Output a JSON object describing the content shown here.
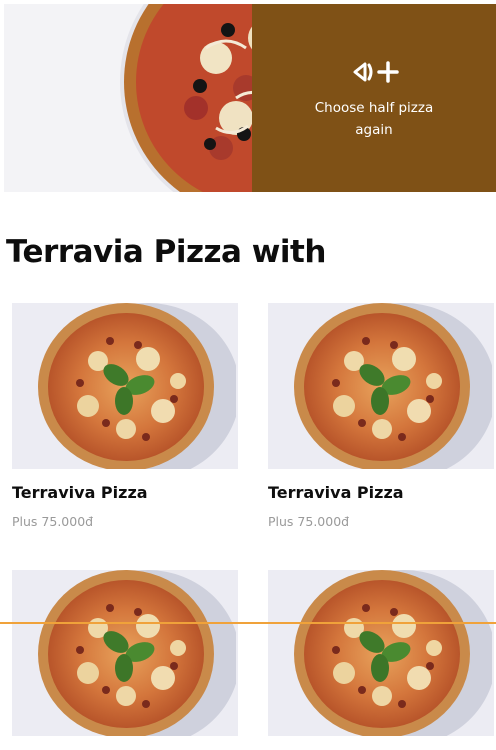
{
  "hero": {
    "cta_text": "Choose half pizza again",
    "icon": "half-pizza-plus-icon",
    "cta_bg": "#7f5116"
  },
  "section": {
    "title": "Terravia Pizza with"
  },
  "products": [
    {
      "name": "Terraviva Pizza",
      "price": "Plus 75.000đ"
    },
    {
      "name": "Terraviva Pizza",
      "price": "Plus 75.000đ"
    },
    {
      "name": "",
      "price": ""
    },
    {
      "name": "",
      "price": ""
    }
  ]
}
